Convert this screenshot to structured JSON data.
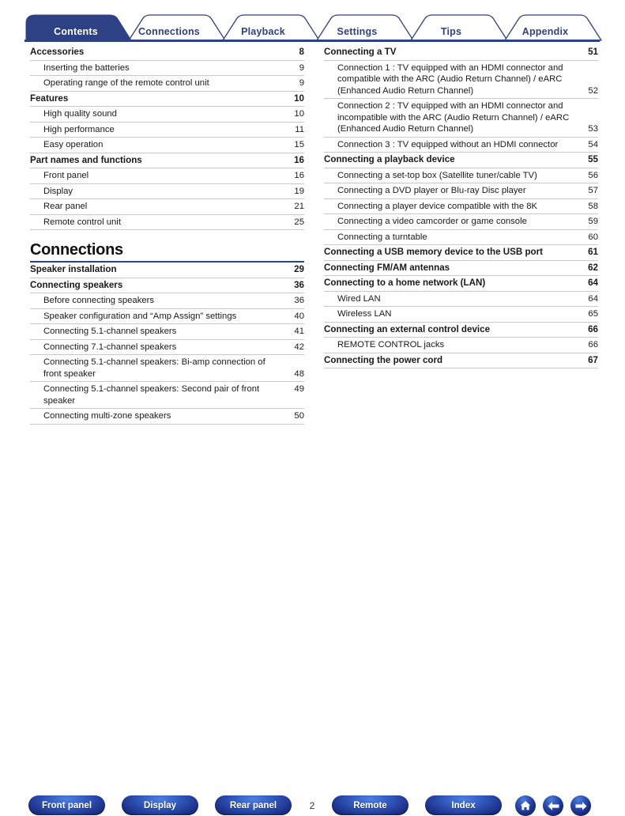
{
  "tabs": [
    {
      "label": "Contents",
      "active": true
    },
    {
      "label": "Connections",
      "active": false
    },
    {
      "label": "Playback",
      "active": false
    },
    {
      "label": "Settings",
      "active": false
    },
    {
      "label": "Tips",
      "active": false
    },
    {
      "label": "Appendix",
      "active": false
    }
  ],
  "colors": {
    "tab_active_fill": "#2e4184",
    "tab_border": "#2e4184",
    "rule": "#2e4184",
    "entry_divider": "#c9c9c9",
    "button_blue": "#2f54b8"
  },
  "left_column": [
    {
      "type": "entry",
      "level": 1,
      "title": "Accessories",
      "page": "8"
    },
    {
      "type": "entry",
      "level": 2,
      "title": "Inserting the batteries",
      "page": "9"
    },
    {
      "type": "entry",
      "level": 2,
      "title": "Operating range of the remote control unit",
      "page": "9"
    },
    {
      "type": "entry",
      "level": 1,
      "title": "Features",
      "page": "10"
    },
    {
      "type": "entry",
      "level": 2,
      "title": "High quality sound",
      "page": "10"
    },
    {
      "type": "entry",
      "level": 2,
      "title": "High performance",
      "page": "11"
    },
    {
      "type": "entry",
      "level": 2,
      "title": "Easy operation",
      "page": "15"
    },
    {
      "type": "entry",
      "level": 1,
      "title": "Part names and functions",
      "page": "16"
    },
    {
      "type": "entry",
      "level": 2,
      "title": "Front panel",
      "page": "16"
    },
    {
      "type": "entry",
      "level": 2,
      "title": "Display",
      "page": "19"
    },
    {
      "type": "entry",
      "level": 2,
      "title": "Rear panel",
      "page": "21"
    },
    {
      "type": "entry",
      "level": 2,
      "title": "Remote control unit",
      "page": "25"
    },
    {
      "type": "section",
      "title": "Connections"
    },
    {
      "type": "entry",
      "level": 1,
      "title": "Speaker installation",
      "page": "29"
    },
    {
      "type": "entry",
      "level": 1,
      "title": "Connecting speakers",
      "page": "36"
    },
    {
      "type": "entry",
      "level": 2,
      "title": "Before connecting speakers",
      "page": "36"
    },
    {
      "type": "entry",
      "level": 2,
      "title": "Speaker configuration and “Amp Assign” settings",
      "page": "40"
    },
    {
      "type": "entry",
      "level": 2,
      "title": "Connecting 5.1-channel speakers",
      "page": "41"
    },
    {
      "type": "entry",
      "level": 2,
      "title": "Connecting 7.1-channel speakers",
      "page": "42"
    },
    {
      "type": "entry",
      "level": 2,
      "title": "Connecting 5.1-channel speakers: Bi-amp connection of front speaker",
      "page": "48",
      "multiline": true
    },
    {
      "type": "entry",
      "level": 2,
      "title": "Connecting 5.1-channel speakers: Second pair of front speaker",
      "page": "49"
    },
    {
      "type": "entry",
      "level": 2,
      "title": "Connecting multi-zone speakers",
      "page": "50"
    }
  ],
  "right_column": [
    {
      "type": "entry",
      "level": 1,
      "title": "Connecting a TV",
      "page": "51"
    },
    {
      "type": "entry",
      "level": 2,
      "title": "Connection 1 : TV equipped with an HDMI connector and compatible with the ARC (Audio Return Channel) / eARC (Enhanced Audio Return Channel)",
      "page": "52",
      "multiline": true
    },
    {
      "type": "entry",
      "level": 2,
      "title": "Connection 2 : TV equipped with an HDMI connector and incompatible with the ARC (Audio Return Channel) / eARC (Enhanced Audio Return Channel)",
      "page": "53",
      "multiline": true
    },
    {
      "type": "entry",
      "level": 2,
      "title": "Connection 3 : TV equipped without an HDMI connector",
      "page": "54"
    },
    {
      "type": "entry",
      "level": 1,
      "title": "Connecting a playback device",
      "page": "55"
    },
    {
      "type": "entry",
      "level": 2,
      "title": "Connecting a set-top box (Satellite tuner/cable TV)",
      "page": "56"
    },
    {
      "type": "entry",
      "level": 2,
      "title": "Connecting a DVD player or Blu-ray Disc player",
      "page": "57"
    },
    {
      "type": "entry",
      "level": 2,
      "title": "Connecting a player device compatible with the 8K",
      "page": "58"
    },
    {
      "type": "entry",
      "level": 2,
      "title": "Connecting a video camcorder or game console",
      "page": "59"
    },
    {
      "type": "entry",
      "level": 2,
      "title": "Connecting a turntable",
      "page": "60"
    },
    {
      "type": "entry",
      "level": 1,
      "title": "Connecting a USB memory device to the USB port",
      "page": "61"
    },
    {
      "type": "entry",
      "level": 1,
      "title": "Connecting FM/AM antennas",
      "page": "62"
    },
    {
      "type": "entry",
      "level": 1,
      "title": "Connecting to a home network (LAN)",
      "page": "64"
    },
    {
      "type": "entry",
      "level": 2,
      "title": "Wired LAN",
      "page": "64"
    },
    {
      "type": "entry",
      "level": 2,
      "title": "Wireless LAN",
      "page": "65"
    },
    {
      "type": "entry",
      "level": 1,
      "title": "Connecting an external control device",
      "page": "66"
    },
    {
      "type": "entry",
      "level": 2,
      "title": "REMOTE CONTROL jacks",
      "page": "66"
    },
    {
      "type": "entry",
      "level": 1,
      "title": "Connecting the power cord",
      "page": "67"
    }
  ],
  "footer": {
    "buttons": [
      {
        "id": "btn-front",
        "label": "Front panel"
      },
      {
        "id": "btn-display",
        "label": "Display"
      },
      {
        "id": "btn-rear",
        "label": "Rear panel"
      },
      {
        "id": "btn-remote",
        "label": "Remote"
      },
      {
        "id": "btn-index",
        "label": "Index"
      }
    ],
    "page_number": "2",
    "icons": [
      {
        "id": "icon-home",
        "name": "home-icon"
      },
      {
        "id": "icon-back",
        "name": "arrow-left-icon"
      },
      {
        "id": "icon-fwd",
        "name": "arrow-right-icon"
      }
    ]
  }
}
